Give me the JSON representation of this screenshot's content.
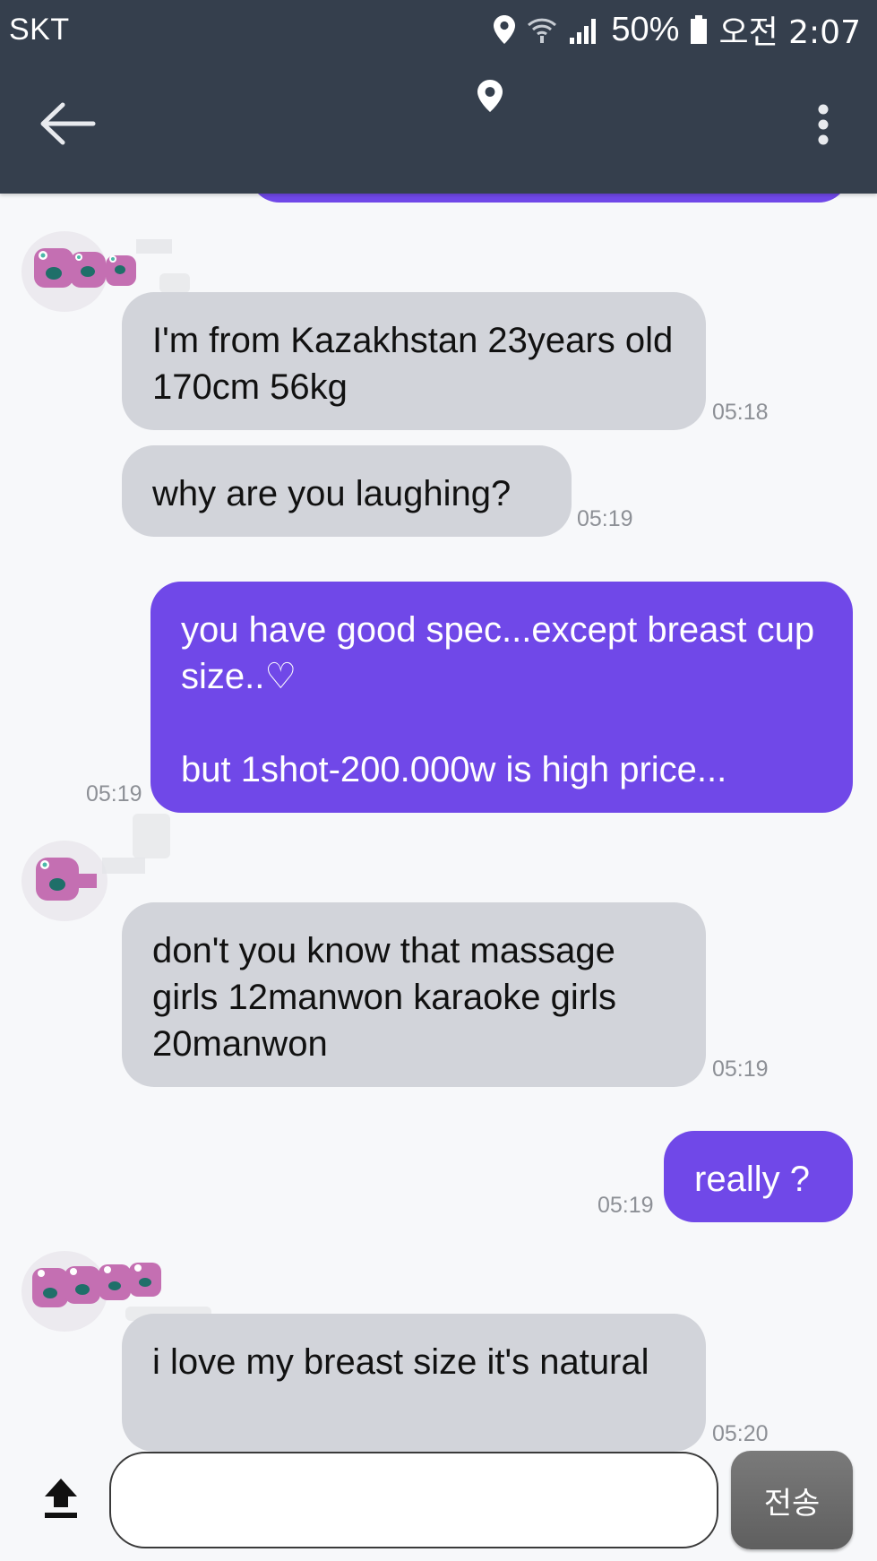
{
  "status_bar": {
    "carrier": "SKT",
    "battery": "50%",
    "time": "오전 2:07"
  },
  "messages": [
    {
      "side": "in",
      "text": "I'm from Kazakhstan 23years old 170cm 56kg",
      "time": "05:18"
    },
    {
      "side": "in",
      "text": "why are you laughing?",
      "time": "05:19"
    },
    {
      "side": "out",
      "text": "you have good spec...except breast cup size..♡\n\nbut 1shot-200.000w is high price...",
      "time": "05:19"
    },
    {
      "side": "in",
      "text": "don't you know that massage girls 12manwon karaoke girls 20manwon",
      "time": "05:19"
    },
    {
      "side": "out",
      "text": "really ?",
      "time": "05:19"
    },
    {
      "side": "in",
      "text": "i love my breast size it's natural",
      "time": "05:20"
    }
  ],
  "composer": {
    "input_value": "",
    "send_label": "전송"
  },
  "icons": {
    "back": "arrow-left-icon",
    "location": "location-pin-icon",
    "menu": "more-vert-icon",
    "upload": "upload-icon",
    "avatar": "monster-avatar-icon"
  },
  "colors": {
    "app_bar": "#353f4d",
    "outgoing_bubble": "#7048e8",
    "incoming_bubble": "#d2d4da",
    "background": "#f7f8fa",
    "send_button": "#6b6b6b"
  }
}
